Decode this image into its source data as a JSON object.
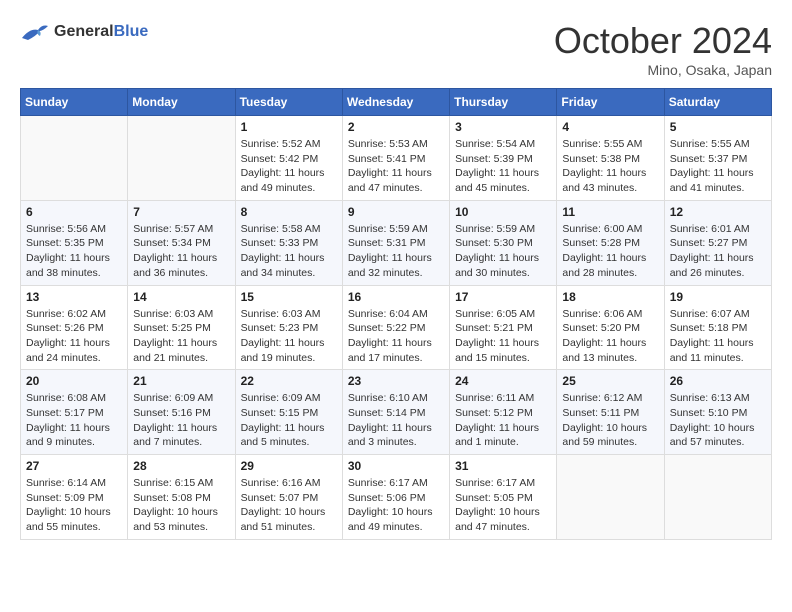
{
  "header": {
    "logo_line1": "General",
    "logo_line2": "Blue",
    "month": "October 2024",
    "location": "Mino, Osaka, Japan"
  },
  "weekdays": [
    "Sunday",
    "Monday",
    "Tuesday",
    "Wednesday",
    "Thursday",
    "Friday",
    "Saturday"
  ],
  "weeks": [
    [
      {
        "day": "",
        "text": ""
      },
      {
        "day": "",
        "text": ""
      },
      {
        "day": "1",
        "text": "Sunrise: 5:52 AM\nSunset: 5:42 PM\nDaylight: 11 hours and 49 minutes."
      },
      {
        "day": "2",
        "text": "Sunrise: 5:53 AM\nSunset: 5:41 PM\nDaylight: 11 hours and 47 minutes."
      },
      {
        "day": "3",
        "text": "Sunrise: 5:54 AM\nSunset: 5:39 PM\nDaylight: 11 hours and 45 minutes."
      },
      {
        "day": "4",
        "text": "Sunrise: 5:55 AM\nSunset: 5:38 PM\nDaylight: 11 hours and 43 minutes."
      },
      {
        "day": "5",
        "text": "Sunrise: 5:55 AM\nSunset: 5:37 PM\nDaylight: 11 hours and 41 minutes."
      }
    ],
    [
      {
        "day": "6",
        "text": "Sunrise: 5:56 AM\nSunset: 5:35 PM\nDaylight: 11 hours and 38 minutes."
      },
      {
        "day": "7",
        "text": "Sunrise: 5:57 AM\nSunset: 5:34 PM\nDaylight: 11 hours and 36 minutes."
      },
      {
        "day": "8",
        "text": "Sunrise: 5:58 AM\nSunset: 5:33 PM\nDaylight: 11 hours and 34 minutes."
      },
      {
        "day": "9",
        "text": "Sunrise: 5:59 AM\nSunset: 5:31 PM\nDaylight: 11 hours and 32 minutes."
      },
      {
        "day": "10",
        "text": "Sunrise: 5:59 AM\nSunset: 5:30 PM\nDaylight: 11 hours and 30 minutes."
      },
      {
        "day": "11",
        "text": "Sunrise: 6:00 AM\nSunset: 5:28 PM\nDaylight: 11 hours and 28 minutes."
      },
      {
        "day": "12",
        "text": "Sunrise: 6:01 AM\nSunset: 5:27 PM\nDaylight: 11 hours and 26 minutes."
      }
    ],
    [
      {
        "day": "13",
        "text": "Sunrise: 6:02 AM\nSunset: 5:26 PM\nDaylight: 11 hours and 24 minutes."
      },
      {
        "day": "14",
        "text": "Sunrise: 6:03 AM\nSunset: 5:25 PM\nDaylight: 11 hours and 21 minutes."
      },
      {
        "day": "15",
        "text": "Sunrise: 6:03 AM\nSunset: 5:23 PM\nDaylight: 11 hours and 19 minutes."
      },
      {
        "day": "16",
        "text": "Sunrise: 6:04 AM\nSunset: 5:22 PM\nDaylight: 11 hours and 17 minutes."
      },
      {
        "day": "17",
        "text": "Sunrise: 6:05 AM\nSunset: 5:21 PM\nDaylight: 11 hours and 15 minutes."
      },
      {
        "day": "18",
        "text": "Sunrise: 6:06 AM\nSunset: 5:20 PM\nDaylight: 11 hours and 13 minutes."
      },
      {
        "day": "19",
        "text": "Sunrise: 6:07 AM\nSunset: 5:18 PM\nDaylight: 11 hours and 11 minutes."
      }
    ],
    [
      {
        "day": "20",
        "text": "Sunrise: 6:08 AM\nSunset: 5:17 PM\nDaylight: 11 hours and 9 minutes."
      },
      {
        "day": "21",
        "text": "Sunrise: 6:09 AM\nSunset: 5:16 PM\nDaylight: 11 hours and 7 minutes."
      },
      {
        "day": "22",
        "text": "Sunrise: 6:09 AM\nSunset: 5:15 PM\nDaylight: 11 hours and 5 minutes."
      },
      {
        "day": "23",
        "text": "Sunrise: 6:10 AM\nSunset: 5:14 PM\nDaylight: 11 hours and 3 minutes."
      },
      {
        "day": "24",
        "text": "Sunrise: 6:11 AM\nSunset: 5:12 PM\nDaylight: 11 hours and 1 minute."
      },
      {
        "day": "25",
        "text": "Sunrise: 6:12 AM\nSunset: 5:11 PM\nDaylight: 10 hours and 59 minutes."
      },
      {
        "day": "26",
        "text": "Sunrise: 6:13 AM\nSunset: 5:10 PM\nDaylight: 10 hours and 57 minutes."
      }
    ],
    [
      {
        "day": "27",
        "text": "Sunrise: 6:14 AM\nSunset: 5:09 PM\nDaylight: 10 hours and 55 minutes."
      },
      {
        "day": "28",
        "text": "Sunrise: 6:15 AM\nSunset: 5:08 PM\nDaylight: 10 hours and 53 minutes."
      },
      {
        "day": "29",
        "text": "Sunrise: 6:16 AM\nSunset: 5:07 PM\nDaylight: 10 hours and 51 minutes."
      },
      {
        "day": "30",
        "text": "Sunrise: 6:17 AM\nSunset: 5:06 PM\nDaylight: 10 hours and 49 minutes."
      },
      {
        "day": "31",
        "text": "Sunrise: 6:17 AM\nSunset: 5:05 PM\nDaylight: 10 hours and 47 minutes."
      },
      {
        "day": "",
        "text": ""
      },
      {
        "day": "",
        "text": ""
      }
    ]
  ]
}
